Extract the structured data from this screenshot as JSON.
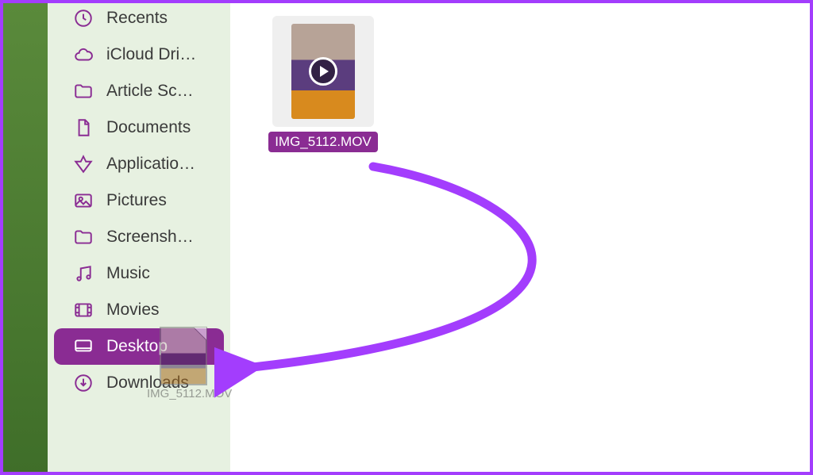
{
  "sidebar": {
    "items": [
      {
        "label": "Recents",
        "icon": "clock-icon"
      },
      {
        "label": "iCloud Dri…",
        "icon": "cloud-icon"
      },
      {
        "label": "Article Sc…",
        "icon": "folder-icon"
      },
      {
        "label": "Documents",
        "icon": "document-icon"
      },
      {
        "label": "Applicatio…",
        "icon": "applications-icon"
      },
      {
        "label": "Pictures",
        "icon": "pictures-icon"
      },
      {
        "label": "Screensh…",
        "icon": "folder-icon"
      },
      {
        "label": "Music",
        "icon": "music-icon"
      },
      {
        "label": "Movies",
        "icon": "movies-icon"
      },
      {
        "label": "Desktop",
        "icon": "desktop-icon",
        "selected": true
      },
      {
        "label": "Downloads",
        "icon": "downloads-icon"
      }
    ]
  },
  "file": {
    "name": "IMG_5112.MOV"
  },
  "drag_ghost": {
    "name": "IMG_5112.MOV"
  },
  "colors": {
    "accent": "#8a2c93",
    "annotation": "#a33dfd"
  }
}
